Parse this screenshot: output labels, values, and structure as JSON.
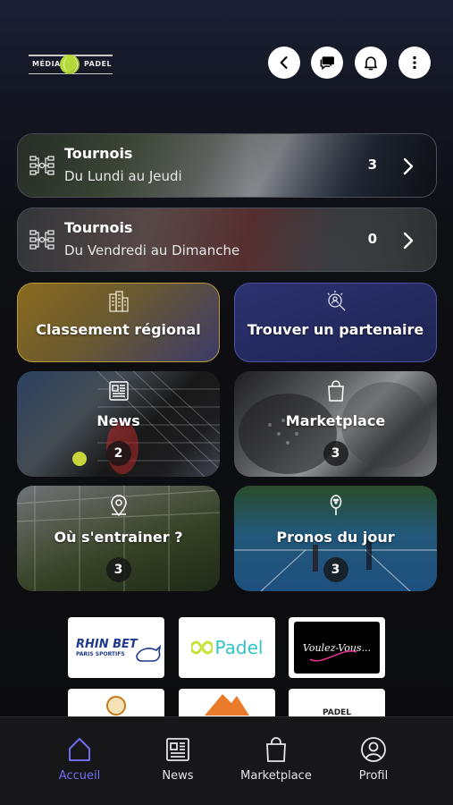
{
  "header": {
    "logo_left": "MÉDIA",
    "logo_right": "PADEL",
    "buttons": [
      "chevron-left-icon",
      "chat-icon",
      "bell-icon",
      "more-vertical-icon"
    ]
  },
  "banners": [
    {
      "title": "Tournois",
      "subtitle": "Du Lundi au Jeudi",
      "count": "3"
    },
    {
      "title": "Tournois",
      "subtitle": "Du Vendredi au Dimanche",
      "count": "0"
    }
  ],
  "tiles": {
    "classement": {
      "label": "Classement régional",
      "icon": "buildings-icon"
    },
    "partenaire": {
      "label": "Trouver un partenaire",
      "icon": "search-people-icon"
    },
    "news": {
      "label": "News",
      "count": "2",
      "icon": "newspaper-icon"
    },
    "marketplace": {
      "label": "Marketplace",
      "count": "3",
      "icon": "shopping-bag-icon"
    },
    "entrainer": {
      "label": "Où s'entrainer ?",
      "count": "3",
      "icon": "location-pin-icon"
    },
    "pronos": {
      "label": "Pronos du jour",
      "count": "3",
      "icon": "racket-icon"
    }
  },
  "sponsors": {
    "rhinbet": {
      "name": "RHIN BET",
      "tagline": "PARIS SPORTIFS"
    },
    "padel": {
      "name": "Padel"
    },
    "voulez": {
      "name": "Voulez-Vous..."
    },
    "bottom_right": {
      "name": "PADEL"
    }
  },
  "nav": {
    "items": [
      {
        "label": "Accueil",
        "icon": "home-icon",
        "active": true
      },
      {
        "label": "News",
        "icon": "newspaper-icon",
        "active": false
      },
      {
        "label": "Marketplace",
        "icon": "shopping-bag-icon",
        "active": false
      },
      {
        "label": "Profil",
        "icon": "user-icon",
        "active": false
      }
    ]
  },
  "colors": {
    "active_nav": "#6f6cf3",
    "classement_gradient": [
      "#8a6a1e",
      "#3b3a68"
    ],
    "partenaire_bg": "#23295a"
  }
}
